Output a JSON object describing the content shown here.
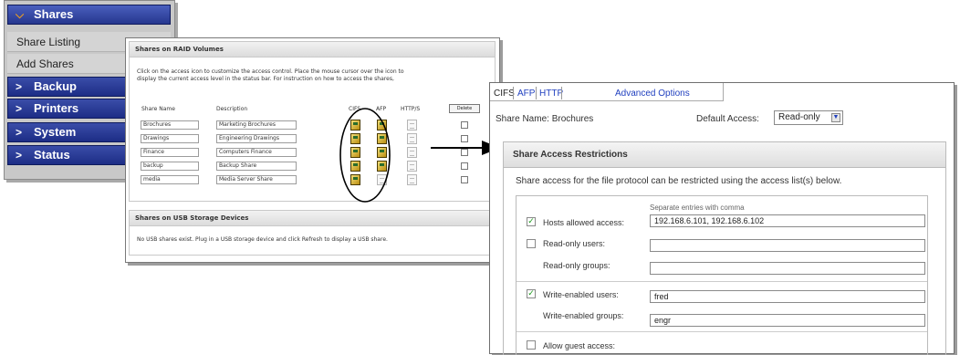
{
  "nav": {
    "items": [
      {
        "label": "Shares",
        "active": true,
        "icon": "chevron-down-icon"
      },
      {
        "label": "Share Listing"
      },
      {
        "label": "Add Shares"
      },
      {
        "label": "Backup",
        "icon": "chevron-right-icon"
      },
      {
        "label": "Printers",
        "icon": "chevron-right-icon"
      },
      {
        "label": "System",
        "icon": "chevron-right-icon"
      },
      {
        "label": "Status",
        "icon": "chevron-right-icon"
      }
    ]
  },
  "raid": {
    "title": "Shares on RAID Volumes",
    "help_line1": "Click on the access icon to customize the access control. Place the mouse cursor over the icon to",
    "help_line2": "display the current access level in the status bar. For instruction on how to access the shares,",
    "columns": {
      "name": "Share Name",
      "desc": "Description",
      "cifs": "CIFS",
      "afp": "AFP",
      "http": "HTTP/S",
      "delete": "Delete"
    },
    "rows": [
      {
        "name": "Brochures",
        "desc": "Marketing Brochures",
        "afp": true
      },
      {
        "name": "Drawings",
        "desc": "Engineering Drawings",
        "afp": true
      },
      {
        "name": "Finance",
        "desc": "Computers Finance",
        "afp": true
      },
      {
        "name": "backup",
        "desc": "Backup Share",
        "afp": true
      },
      {
        "name": "media",
        "desc": "Media Server Share",
        "afp": false
      }
    ]
  },
  "usb": {
    "title": "Shares on USB Storage Devices",
    "message": "No USB shares exist. Plug in a USB storage device and click Refresh to display a USB share."
  },
  "access": {
    "tabs": [
      "CIFS",
      "AFP",
      "HTTP"
    ],
    "advanced": "Advanced Options",
    "share_name_label": "Share Name:",
    "share_name": "Brochures",
    "default_access_label": "Default Access:",
    "default_access": "Read-only",
    "section_title": "Share Access Restrictions",
    "intro": "Share access for the file protocol can be restricted using the access list(s) below.",
    "hint": "Separate entries with comma",
    "fields": [
      {
        "label": "Hosts allowed access:",
        "checked": true,
        "value": "192.168.6.101, 192.168.6.102"
      },
      {
        "label": "Read-only users:",
        "checked": false,
        "value": ""
      },
      {
        "label": "Read-only groups:",
        "value": ""
      },
      {
        "label": "Write-enabled users:",
        "checked": true,
        "value": "fred"
      },
      {
        "label": "Write-enabled groups:",
        "value": "engr"
      }
    ],
    "guest_label": "Allow guest access:"
  },
  "colors": {
    "nav_blue": "#26378f",
    "accent_orange": "#f0a020",
    "link_blue": "#1f3fbf"
  }
}
